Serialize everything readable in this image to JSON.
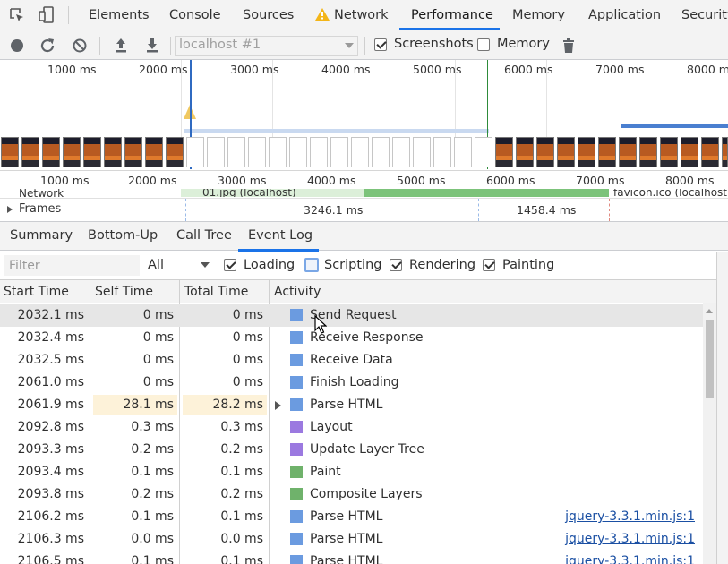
{
  "tabs": [
    "Elements",
    "Console",
    "Sources",
    "Network",
    "Performance",
    "Memory",
    "Application",
    "Security"
  ],
  "active_tab": "Performance",
  "network_warning": "warning-triangle-icon",
  "toolbar": {
    "profile_select": "localhost #1",
    "screenshots_label": "Screenshots",
    "screenshots_checked": true,
    "memory_label": "Memory",
    "memory_checked": false
  },
  "overview": {
    "top_ruler": [
      "1000 ms",
      "2000 ms",
      "3000 ms",
      "4000 ms",
      "5000 ms",
      "6000 ms",
      "7000 ms",
      "8000 ms"
    ],
    "bottom_ruler": [
      "1000 ms",
      "2000 ms",
      "3000 ms",
      "4000 ms",
      "5000 ms",
      "6000 ms",
      "7000 ms",
      "8000 ms"
    ],
    "network_label": "Network",
    "network_req_1": "01.jpg (localhost)",
    "network_req_2": "favicon.ico (localhost)",
    "frames_label": "Frames",
    "frame_1": "3246.1 ms",
    "frame_2": "1458.4 ms"
  },
  "subtabs": [
    "Summary",
    "Bottom-Up",
    "Call Tree",
    "Event Log"
  ],
  "active_subtab": "Event Log",
  "filter": {
    "placeholder": "Filter",
    "select": "All",
    "loading": "Loading",
    "scripting": "Scripting",
    "rendering": "Rendering",
    "painting": "Painting"
  },
  "table": {
    "headers": [
      "Start Time",
      "Self Time",
      "Total Time",
      "Activity"
    ],
    "rows": [
      {
        "start": "2032.1 ms",
        "self": "0 ms",
        "total": "0 ms",
        "activity": "Send Request",
        "color": "#6b9be0",
        "link": "",
        "selected": true
      },
      {
        "start": "2032.4 ms",
        "self": "0 ms",
        "total": "0 ms",
        "activity": "Receive Response",
        "color": "#6b9be0",
        "link": ""
      },
      {
        "start": "2032.5 ms",
        "self": "0 ms",
        "total": "0 ms",
        "activity": "Receive Data",
        "color": "#6b9be0",
        "link": ""
      },
      {
        "start": "2061.0 ms",
        "self": "0 ms",
        "total": "0 ms",
        "activity": "Finish Loading",
        "color": "#6b9be0",
        "link": ""
      },
      {
        "start": "2061.9 ms",
        "self": "28.1 ms",
        "total": "28.2 ms",
        "activity": "Parse HTML",
        "color": "#6b9be0",
        "link": "",
        "expandable": true,
        "highlight": true
      },
      {
        "start": "2092.8 ms",
        "self": "0.3 ms",
        "total": "0.3 ms",
        "activity": "Layout",
        "color": "#9b79e0",
        "link": ""
      },
      {
        "start": "2093.3 ms",
        "self": "0.2 ms",
        "total": "0.2 ms",
        "activity": "Update Layer Tree",
        "color": "#9b79e0",
        "link": ""
      },
      {
        "start": "2093.4 ms",
        "self": "0.1 ms",
        "total": "0.1 ms",
        "activity": "Paint",
        "color": "#6fb26b",
        "link": ""
      },
      {
        "start": "2093.8 ms",
        "self": "0.2 ms",
        "total": "0.2 ms",
        "activity": "Composite Layers",
        "color": "#6fb26b",
        "link": ""
      },
      {
        "start": "2106.2 ms",
        "self": "0.1 ms",
        "total": "0.1 ms",
        "activity": "Parse HTML",
        "color": "#6b9be0",
        "link": "jquery-3.3.1.min.js:1"
      },
      {
        "start": "2106.3 ms",
        "self": "0.0 ms",
        "total": "0.0 ms",
        "activity": "Parse HTML",
        "color": "#6b9be0",
        "link": "jquery-3.3.1.min.js:1"
      },
      {
        "start": "2106.5 ms",
        "self": "0.1 ms",
        "total": "0.1 ms",
        "activity": "Parse HTML",
        "color": "#6b9be0",
        "link": "jquery-3.3.1.min.js:1"
      }
    ]
  }
}
